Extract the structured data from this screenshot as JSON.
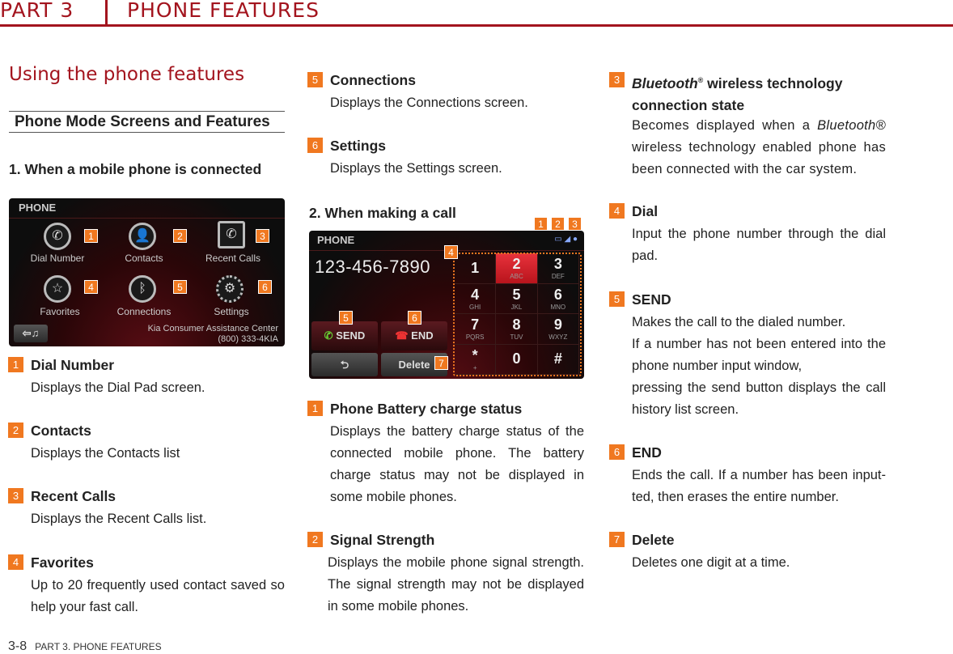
{
  "header": {
    "part": "PART 3",
    "section": "PHONE FEATURES"
  },
  "page_title": "Using the phone features",
  "subtitle": "Phone Mode Screens and Features",
  "section1": {
    "heading": "1. When a mobile phone is connected",
    "screen": {
      "title": "PHONE",
      "icons": [
        "Dial Number",
        "Contacts",
        "Recent Calls",
        "Favorites",
        "Connections",
        "Settings"
      ],
      "assist_line1": "Kia Consumer Assistance Center",
      "assist_line2": "(800) 333-4KIA",
      "badges": [
        "1",
        "2",
        "3",
        "4",
        "5",
        "6"
      ]
    },
    "items": [
      {
        "n": "1",
        "title": "Dial Number",
        "desc": "Displays the Dial Pad screen."
      },
      {
        "n": "2",
        "title": "Contacts",
        "desc": "Displays the Contacts list"
      },
      {
        "n": "3",
        "title": "Recent Calls",
        "desc": "Displays the Recent Calls list."
      },
      {
        "n": "4",
        "title": "Favorites",
        "desc": "Up to 20 frequently used contact saved so help your fast call."
      },
      {
        "n": "5",
        "title": "Connections",
        "desc": "Displays the Connections screen."
      },
      {
        "n": "6",
        "title": "Settings",
        "desc": "Displays the Settings screen."
      }
    ]
  },
  "section2": {
    "heading": "2. When making a call",
    "screen": {
      "title": "PHONE",
      "number": "123-456-7890",
      "send": "SEND",
      "end": "END",
      "delete": "Delete",
      "keys": [
        [
          "1",
          ""
        ],
        [
          "2",
          "ABC"
        ],
        [
          "3",
          "DEF"
        ],
        [
          "4",
          "GHI"
        ],
        [
          "5",
          "JKL"
        ],
        [
          "6",
          "MNO"
        ],
        [
          "7",
          "PQRS"
        ],
        [
          "8",
          "TUV"
        ],
        [
          "9",
          "WXYZ"
        ],
        [
          "*",
          "+"
        ],
        [
          "0",
          ""
        ],
        [
          "#",
          ""
        ]
      ],
      "badges": [
        "1",
        "2",
        "3",
        "4",
        "5",
        "6",
        "7"
      ]
    },
    "items": [
      {
        "n": "1",
        "title": "Phone Battery charge status",
        "desc": "Displays the battery charge status of the connected mobile phone. The battery charge status may not be displayed in some mobile phones."
      },
      {
        "n": "2",
        "title": "Signal Strength",
        "desc": "Displays the mobile phone signal strength. The signal strength may not be displayed in some mobile phones."
      },
      {
        "n": "3",
        "title_italic": "Bluetooth",
        "title_reg": "®",
        "title_rest": " wireless technology connection state",
        "desc_a": "Becomes displayed when a ",
        "desc_italic": "Bluetooth®",
        "desc_b": " wireless technology enabled phone has been connected with the car system."
      },
      {
        "n": "4",
        "title": "Dial",
        "desc": "Input the phone number through the dial pad."
      },
      {
        "n": "5",
        "title": "SEND",
        "desc": "Makes the call to the dialed number.\nIf a number has not been entered into the phone number input window,\npressing the send button displays the call history list screen."
      },
      {
        "n": "6",
        "title": "END",
        "desc": "Ends the call. If a number has been input-ted, then erases the entire number."
      },
      {
        "n": "7",
        "title": "Delete",
        "desc": "Deletes one digit at a time."
      }
    ]
  },
  "footer": {
    "page": "3-8",
    "label": "PART 3. PHONE FEATURES"
  },
  "colors": {
    "brand_red": "#a3141e",
    "badge_orange": "#f07820"
  }
}
